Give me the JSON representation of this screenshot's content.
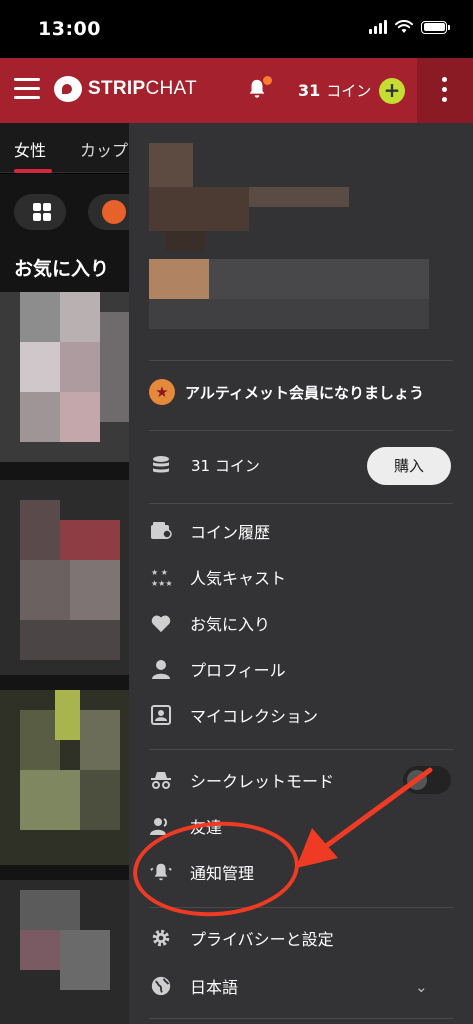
{
  "status_bar": {
    "time": "13:00"
  },
  "header": {
    "brand_bold": "STRIP",
    "brand_light": "CHAT",
    "coin_count": "31",
    "coin_label": "コイン",
    "plus_symbol": "+"
  },
  "background": {
    "tabs": [
      "女性",
      "カップ"
    ],
    "section_title": "お気に入り"
  },
  "menu": {
    "ultimate_label": "アルティメット会員になりましょう",
    "coins_label": "31 コイン",
    "buy_label": "購入",
    "items": [
      {
        "label": "コイン履歴",
        "icon": "wallet-icon"
      },
      {
        "label": "人気キャスト",
        "icon": "popular-cast-icon"
      },
      {
        "label": "お気に入り",
        "icon": "heart-icon"
      },
      {
        "label": "プロフィール",
        "icon": "user-icon"
      },
      {
        "label": "マイコレクション",
        "icon": "collection-icon"
      },
      {
        "label": "シークレットモード",
        "icon": "incognito-icon"
      },
      {
        "label": "友達",
        "icon": "friends-icon"
      },
      {
        "label": "通知管理",
        "icon": "bell-icon"
      },
      {
        "label": "プライバシーと設定",
        "icon": "gear-icon"
      },
      {
        "label": "日本語",
        "icon": "globe-icon"
      }
    ],
    "secret_mode_on": false
  },
  "colors": {
    "header_red": "#a4212d",
    "menu_bg": "#333335",
    "annotation_red": "#ef3b24",
    "plus_green": "#c4dd32"
  }
}
